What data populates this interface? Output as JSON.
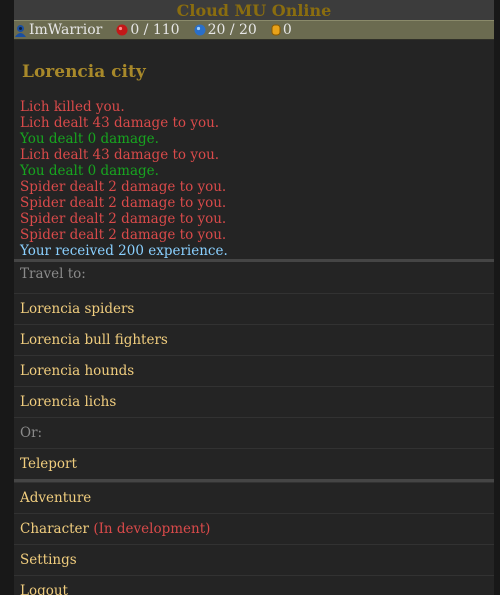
{
  "header": {
    "title": "Cloud MU Online"
  },
  "status": {
    "username": "ImWarrior",
    "hp": "0 / 110",
    "mana": "20 / 20",
    "gold": "0"
  },
  "location": {
    "name": "Lorencia city"
  },
  "log": [
    {
      "text": "Lich killed you.",
      "color": "red"
    },
    {
      "text": "Lich dealt 43 damage to you.",
      "color": "red"
    },
    {
      "text": "You dealt 0 damage.",
      "color": "green"
    },
    {
      "text": "Lich dealt 43 damage to you.",
      "color": "red"
    },
    {
      "text": "You dealt 0 damage.",
      "color": "green"
    },
    {
      "text": "Spider dealt 2 damage to you.",
      "color": "red"
    },
    {
      "text": "Spider dealt 2 damage to you.",
      "color": "red"
    },
    {
      "text": "Spider dealt 2 damage to you.",
      "color": "red"
    },
    {
      "text": "Spider dealt 2 damage to you.",
      "color": "red"
    },
    {
      "text": "Your received 200 experience.",
      "color": "blue"
    }
  ],
  "travel": {
    "heading": "Travel to:",
    "destinations": [
      "Lorencia spiders",
      "Lorencia bull fighters",
      "Lorencia hounds",
      "Lorencia lichs"
    ],
    "or_label": "Or:",
    "teleport": "Teleport"
  },
  "menu": {
    "adventure": "Adventure",
    "character": "Character",
    "character_note": "(In development)",
    "settings": "Settings",
    "logout": "Logout"
  },
  "colors": {
    "link": "#f0cd7e",
    "damage_taken": "#d94a4a",
    "damage_dealt": "#17a51f",
    "experience": "#8ad0ff",
    "location": "#a8892a"
  }
}
